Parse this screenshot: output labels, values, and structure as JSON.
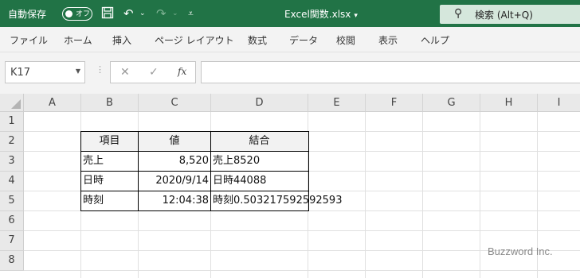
{
  "titlebar": {
    "autosave_label": "自動保存",
    "autosave_state": "オフ",
    "filename": "Excel関数.xlsx",
    "search_label": "検索 (Alt+Q)",
    "accent_color": "#217346"
  },
  "ribbon": {
    "tabs": [
      "ファイル",
      "ホーム",
      "挿入",
      "ページ レイアウト",
      "数式",
      "データ",
      "校閲",
      "表示",
      "ヘルプ"
    ]
  },
  "formula_bar": {
    "name_box": "K17",
    "formula": ""
  },
  "sheet": {
    "columns": [
      "A",
      "B",
      "C",
      "D",
      "E",
      "F",
      "G",
      "H",
      "I"
    ],
    "rows": [
      "1",
      "2",
      "3",
      "4",
      "5",
      "6",
      "7",
      "8"
    ],
    "table": {
      "headers": [
        "項目",
        "値",
        "結合"
      ],
      "rows": [
        [
          "売上",
          "8,520",
          "売上8520"
        ],
        [
          "日時",
          "2020/9/14",
          "日時44088"
        ],
        [
          "時刻",
          "12:04:38",
          "時刻0.503217592592593"
        ]
      ]
    }
  },
  "watermark": "Buzzword Inc."
}
